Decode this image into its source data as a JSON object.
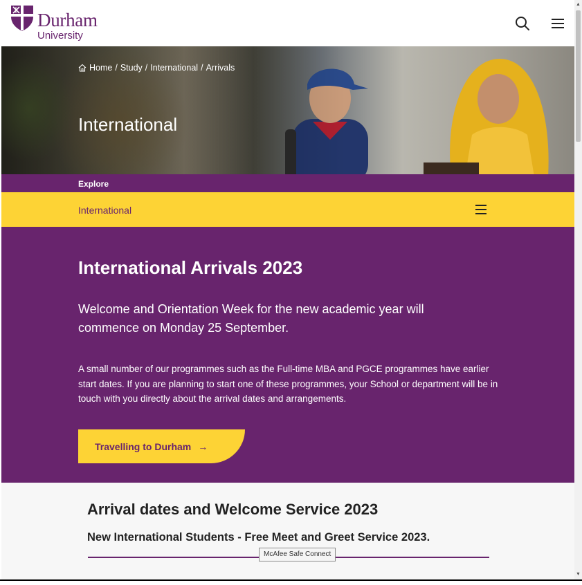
{
  "header": {
    "logo_name": "Durham",
    "logo_sub": "University",
    "search_icon": "search-icon",
    "menu_icon": "hamburger-menu-icon"
  },
  "hero": {
    "breadcrumb": [
      "Home",
      "Study",
      "International",
      "Arrivals"
    ],
    "title": "International"
  },
  "explore": {
    "label": "Explore"
  },
  "section_nav": {
    "label": "International",
    "menu_icon": "hamburger-menu-icon"
  },
  "intro": {
    "title": "International Arrivals 2023",
    "lead": "Welcome and Orientation Week for the new academic year will commence on Monday 25 September.",
    "body": "A small number of our programmes such as the Full-time MBA and PGCE programmes have earlier start dates. If you are planning to start one of these programmes, your School or department will be in touch with you directly about the arrival dates and arrangements.",
    "cta_label": "Travelling to Durham",
    "cta_arrow": "→"
  },
  "arrival": {
    "heading": "Arrival dates and Welcome Service 2023",
    "subheading_a": "New International Students - Free Meet and Greet Service",
    "subheading_b": "2023."
  },
  "tooltip": {
    "text": "McAfee Safe Connect"
  },
  "colors": {
    "purple": "#68246d",
    "yellow": "#fdd335"
  }
}
